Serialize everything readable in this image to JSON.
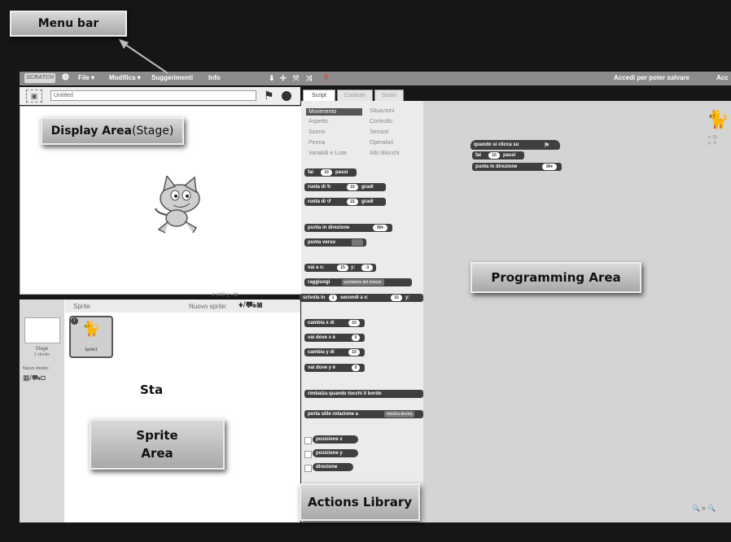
{
  "callouts": {
    "menu_bar": "Menu bar",
    "display_area": "Display Area",
    "display_area_stage": "(Stage)",
    "sprite_area_line1": "Sprite",
    "sprite_area_line2": "Area",
    "sta": "Sta",
    "programming_area": "Programming Area",
    "actions_library": "Actions Library"
  },
  "menubar": {
    "logo": "SCRATCH",
    "file": "File ▾",
    "edit": "Modifica ▾",
    "tips": "Suggerimenti",
    "info": "Info",
    "login": "Accedi per poter salvare",
    "login_cut": "Acc"
  },
  "stage": {
    "project_title": "Untitled",
    "coords": "x: 240  y: -66"
  },
  "sprite_panel": {
    "header": "Sprite",
    "new_sprite": "Nuovo sprite:",
    "stage_label": "Stage",
    "stage_backdrop": "1 sfondo",
    "new_backdrop": "Nuovo sfondo:",
    "sprite1": "Sprite1"
  },
  "tabs": [
    "Script",
    "Costumi",
    "Suoni"
  ],
  "categories": {
    "left": [
      "Movimento",
      "Aspetto",
      "Suono",
      "Penna",
      "Variabili e Liste"
    ],
    "right": [
      "Situazioni",
      "Controllo",
      "Sensori",
      "Operatori",
      "Altri Blocchi"
    ]
  },
  "blocks": {
    "move": "fai",
    "move_val": "10",
    "move_end": "passi",
    "turn_right": "ruota di ↻",
    "turn_val": "15",
    "degrees": "gradi",
    "turn_left": "ruota di ↺",
    "point_dir": "punta in direzione",
    "point_dir_val": "90▾",
    "point_towards": "punta verso",
    "goto_xy": "vai a x:",
    "goto_x_val": "15",
    "y": "y:",
    "goto_y_val": "-3",
    "goto": "raggiungi",
    "goto_dd": "puntatore del mouse",
    "glide": "scivola in",
    "glide_val": "1",
    "glide_mid": "secondi a x:",
    "change_x": "cambia x di",
    "change_x_val": "10",
    "set_x": "vai dove x è",
    "set_x_val": "0",
    "change_y": "cambia y di",
    "change_y_val": "10",
    "set_y": "vai dove y è",
    "set_y_val": "0",
    "bounce": "rimbalza quando tocchi il bordo",
    "rotation": "porta stile rotazione a",
    "rotation_dd": "sinistra-destra",
    "x_pos": "posizione x",
    "y_pos": "posizione y",
    "direction": "direzione"
  },
  "script": {
    "hat": "quando si clicca su",
    "move": "fai",
    "move_val": "10",
    "move_end": "passi",
    "point": "punta in direzione",
    "point_val": "90▾",
    "sprite_x": "x: 15",
    "sprite_y": "y: -3",
    "zoom": "🔍 = 🔍"
  }
}
